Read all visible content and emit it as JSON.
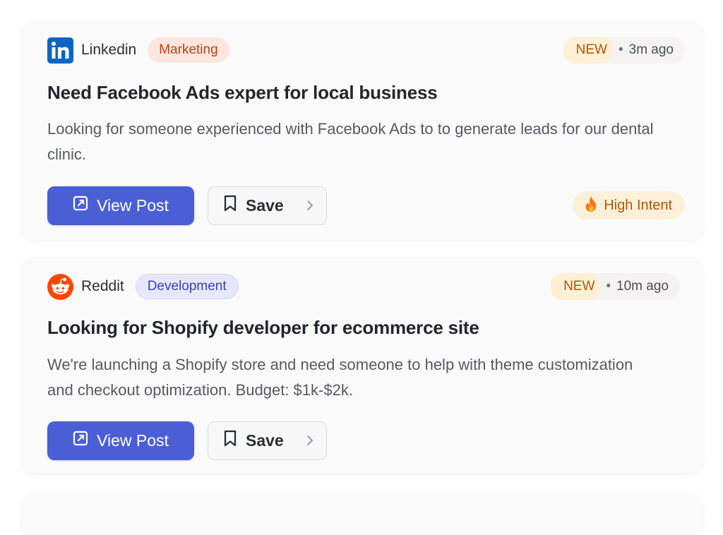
{
  "posts": [
    {
      "platform": "Linkedin",
      "platform_icon": "linkedin-icon",
      "category": "Marketing",
      "new_label": "NEW",
      "separator": "•",
      "time": "3m ago",
      "title": "Need Facebook Ads expert for local business",
      "description": "Looking for someone experienced with Facebook Ads to to generate leads for our dental clinic.",
      "view_label": "View Post",
      "save_label": "Save",
      "intent_label": "High Intent",
      "intent_icon": "fire-icon"
    },
    {
      "platform": "Reddit",
      "platform_icon": "reddit-icon",
      "category": "Development",
      "new_label": "NEW",
      "separator": "•",
      "time": "10m ago",
      "title": "Looking for Shopify developer for ecommerce site",
      "description": "We're launching a Shopify store and need someone to help with theme customization and checkout optimization. Budget: $1k-$2k.",
      "view_label": "View Post",
      "save_label": "Save"
    }
  ],
  "colors": {
    "primary": "#4a5fd6",
    "linkedin": "#0a66c2",
    "reddit": "#ff4500",
    "marketing_tag_bg": "#fde6df",
    "development_tag_bg": "#e6e7fb",
    "intent_bg": "#fdf0d8"
  },
  "icons": {
    "view": "external-link-icon",
    "save": "bookmark-icon",
    "chevron": "chevron-right-icon"
  }
}
